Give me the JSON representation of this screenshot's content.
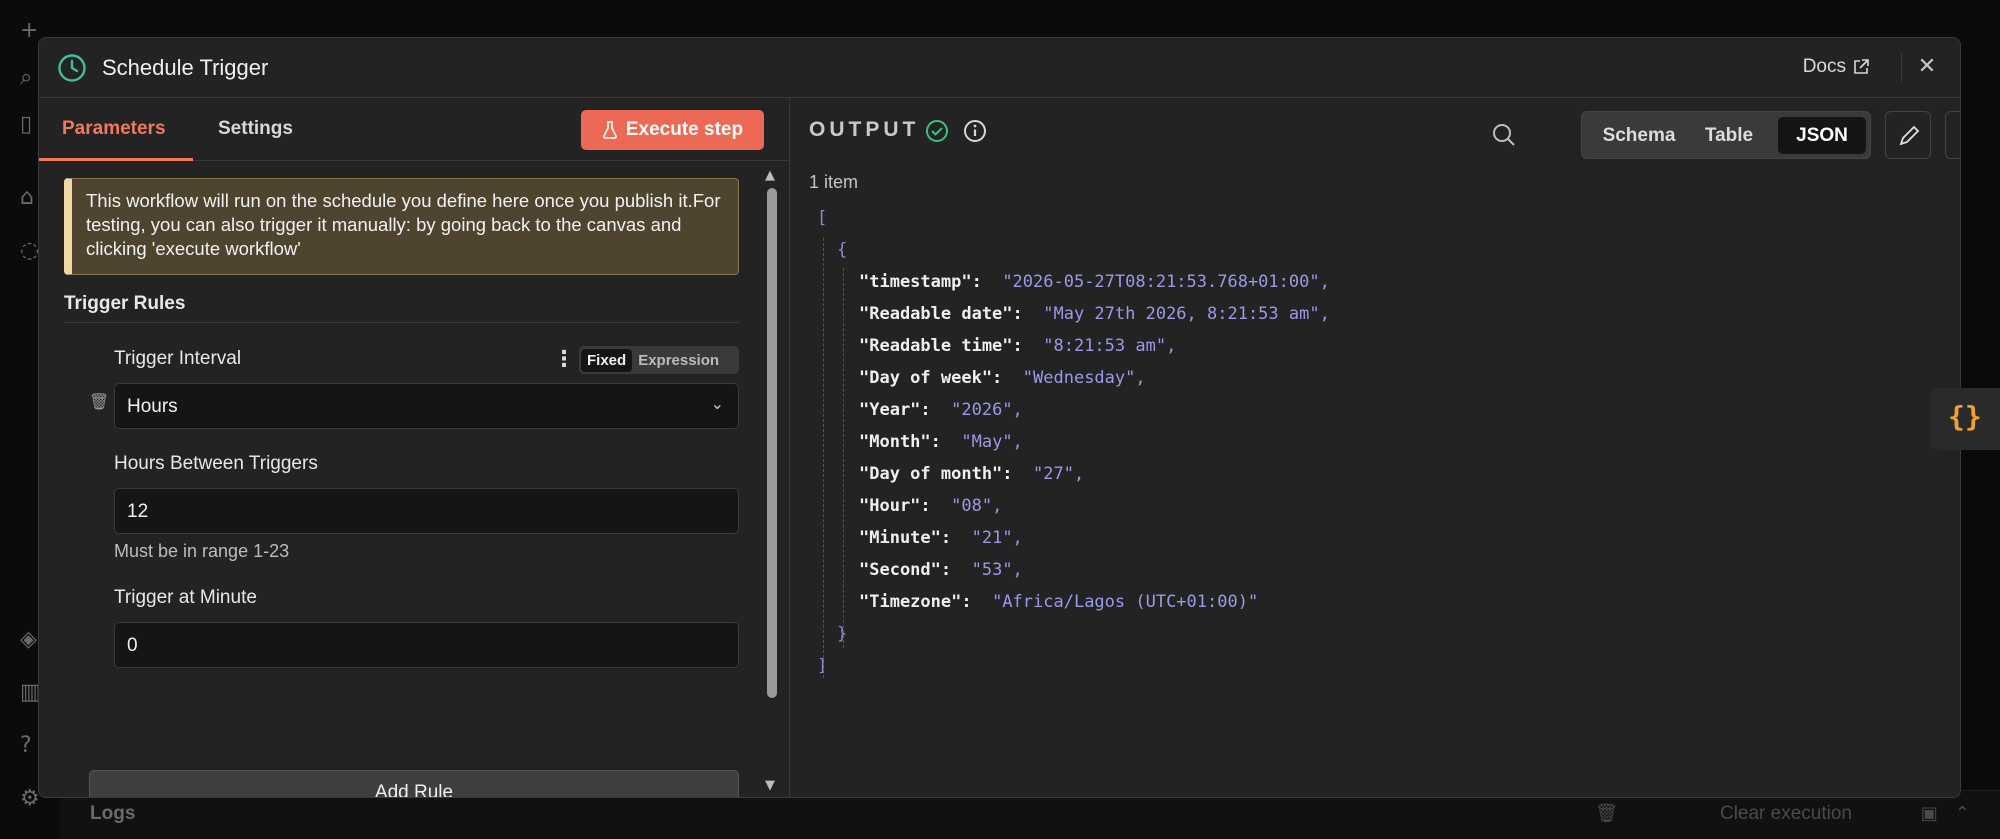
{
  "background": {
    "logs_label": "Logs",
    "clear_label": "Clear execution"
  },
  "modal": {
    "title": "Schedule Trigger",
    "docs_label": "Docs",
    "close_icon": "close-icon"
  },
  "parameters_panel": {
    "tabs": [
      {
        "label": "Parameters",
        "active": true
      },
      {
        "label": "Settings",
        "active": false
      }
    ],
    "execute_button": "Execute step",
    "notice": "This workflow will run on the schedule you define here once you publish it.For testing, you can also trigger it manually: by going back to the canvas and clicking 'execute workflow'",
    "section_title": "Trigger Rules",
    "trigger_interval": {
      "label": "Trigger Interval",
      "value": "Hours",
      "mode_fixed": "Fixed",
      "mode_expression": "Expression"
    },
    "hours_between": {
      "label": "Hours Between Triggers",
      "value": "12",
      "hint": "Must be in range 1-23"
    },
    "trigger_minute": {
      "label": "Trigger at Minute",
      "value": "0"
    },
    "add_rule": "Add Rule"
  },
  "output_panel": {
    "title": "OUTPUT",
    "item_count": "1 item",
    "views": [
      "Schema",
      "Table",
      "JSON"
    ],
    "active_view": "JSON",
    "json": {
      "open_array": "[",
      "open_obj": "{",
      "entries": [
        {
          "key": "\"timestamp\":",
          "value": "\"2026-05-27T08:21:53.768+01:00\","
        },
        {
          "key": "\"Readable date\":",
          "value": "\"May 27th 2026, 8:21:53 am\","
        },
        {
          "key": "\"Readable time\":",
          "value": "\"8:21:53 am\","
        },
        {
          "key": "\"Day of week\":",
          "value": "\"Wednesday\","
        },
        {
          "key": "\"Year\":",
          "value": "\"2026\","
        },
        {
          "key": "\"Month\":",
          "value": "\"May\","
        },
        {
          "key": "\"Day of month\":",
          "value": "\"27\","
        },
        {
          "key": "\"Hour\":",
          "value": "\"08\","
        },
        {
          "key": "\"Minute\":",
          "value": "\"21\","
        },
        {
          "key": "\"Second\":",
          "value": "\"53\","
        },
        {
          "key": "\"Timezone\":",
          "value": "\"Africa/Lagos (UTC+01:00)\""
        }
      ],
      "close_obj": "}",
      "close_array": "]"
    }
  },
  "side_tab": {
    "icon": "braces-icon",
    "glyph": "{}"
  },
  "colors": {
    "accent": "#ec6a55",
    "success": "#3fbf7f",
    "json_value": "#9a9ae6"
  }
}
